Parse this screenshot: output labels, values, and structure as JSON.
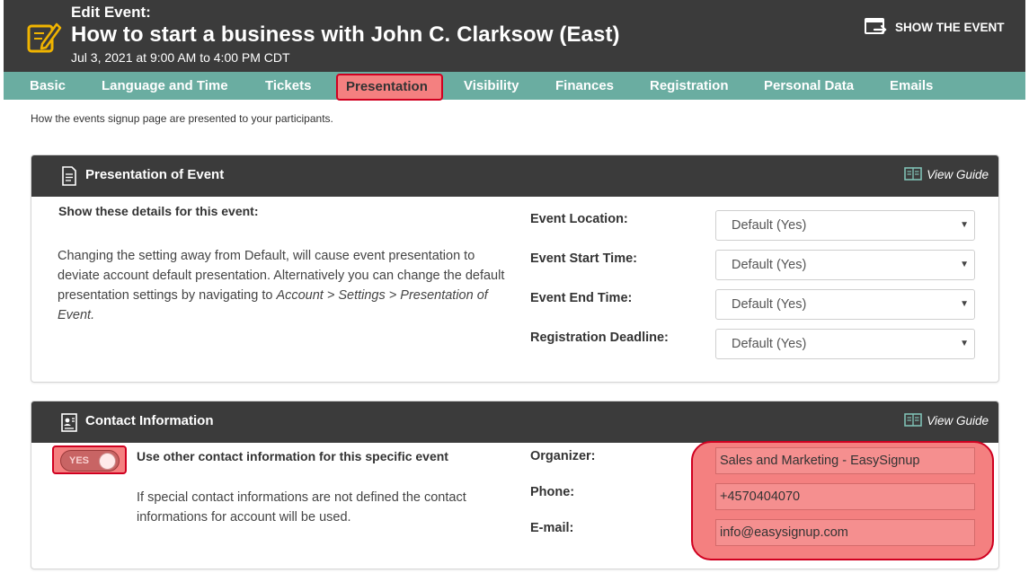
{
  "header": {
    "kicker": "Edit Event:",
    "title": "How to start a business with John C. Clarksow (East)",
    "date": "Jul 3, 2021 at 9:00 AM to 4:00 PM CDT",
    "show_button": "SHOW THE EVENT",
    "icon": "edit-icon"
  },
  "tabs": [
    "Basic",
    "Language and Time",
    "Tickets",
    "Presentation",
    "Visibility",
    "Finances",
    "Registration",
    "Personal Data",
    "Emails"
  ],
  "active_tab": "Presentation",
  "intro": "How the events signup page are presented to your participants.",
  "presentation_panel": {
    "title": "Presentation of Event",
    "guide": "View Guide",
    "subtitle": "Show these details for this event:",
    "description_plain": "Changing the setting away from Default, will cause event presentation to deviate account default presentation. Alternatively you can change the default presentation settings by navigating to",
    "description_path": "Account > Settings > Presentation of Event",
    "description_end": ".",
    "fields": [
      {
        "label": "Event Location:",
        "value": "Default (Yes)"
      },
      {
        "label": "Event Start Time:",
        "value": "Default (Yes)"
      },
      {
        "label": "Event End Time:",
        "value": "Default (Yes)"
      },
      {
        "label": "Registration Deadline:",
        "value": "Default (Yes)"
      }
    ]
  },
  "contact_panel": {
    "title": "Contact Information",
    "guide": "View Guide",
    "toggle_label": "YES",
    "toggle_on": true,
    "option_label": "Use other contact information for this specific event",
    "note": "If special contact informations are not defined the contact informations for account will be used.",
    "fields": [
      {
        "label": "Organizer:",
        "value": "Sales and Marketing - EasySignup"
      },
      {
        "label": "Phone:",
        "value": "+4570404070"
      },
      {
        "label": "E-mail:",
        "value": "info@easysignup.com"
      }
    ]
  },
  "colors": {
    "header_bg": "#3b3b3b",
    "tab_bar_bg": "#6aada1",
    "highlight_fill": "#f48080",
    "highlight_border": "#d00020"
  }
}
